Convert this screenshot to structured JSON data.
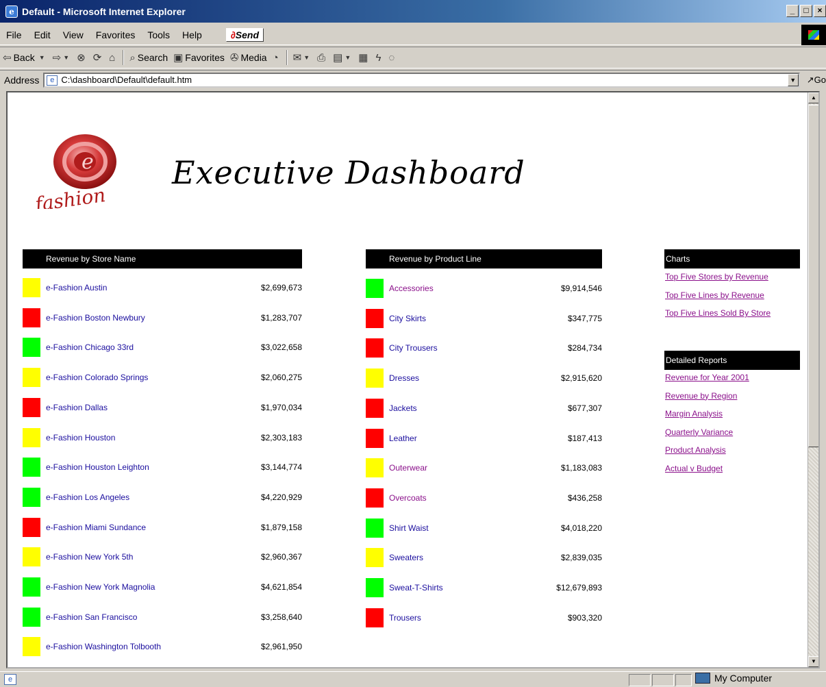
{
  "window": {
    "title": "Default - Microsoft Internet Explorer",
    "buttons": [
      "_",
      "□",
      "×"
    ]
  },
  "menu": [
    "File",
    "Edit",
    "View",
    "Favorites",
    "Tools",
    "Help"
  ],
  "send_label": "Send",
  "toolbar": {
    "back": "Back",
    "search": "Search",
    "favorites": "Favorites",
    "media": "Media"
  },
  "address": {
    "label": "Address",
    "url": "C:\\dashboard\\Default\\default.htm",
    "go": "Go"
  },
  "page": {
    "logo_text": "fashion",
    "logo_letter": "e",
    "title": "Executive Dashboard"
  },
  "colors": {
    "green": "#00ff00",
    "yellow": "#ffff00",
    "red": "#ff0000"
  },
  "store_panel": {
    "header": "Revenue by Store Name",
    "rows": [
      {
        "name": "e-Fashion Austin",
        "value": "$2,699,673",
        "status": "yellow"
      },
      {
        "name": "e-Fashion Boston Newbury",
        "value": "$1,283,707",
        "status": "red"
      },
      {
        "name": "e-Fashion Chicago 33rd",
        "value": "$3,022,658",
        "status": "green"
      },
      {
        "name": "e-Fashion Colorado Springs",
        "value": "$2,060,275",
        "status": "yellow"
      },
      {
        "name": "e-Fashion Dallas",
        "value": "$1,970,034",
        "status": "red"
      },
      {
        "name": "e-Fashion Houston",
        "value": "$2,303,183",
        "status": "yellow"
      },
      {
        "name": "e-Fashion Houston Leighton",
        "value": "$3,144,774",
        "status": "green"
      },
      {
        "name": "e-Fashion Los Angeles",
        "value": "$4,220,929",
        "status": "green"
      },
      {
        "name": "e-Fashion Miami Sundance",
        "value": "$1,879,158",
        "status": "red"
      },
      {
        "name": "e-Fashion New York 5th",
        "value": "$2,960,367",
        "status": "yellow"
      },
      {
        "name": "e-Fashion New York Magnolia",
        "value": "$4,621,854",
        "status": "green"
      },
      {
        "name": "e-Fashion San Francisco",
        "value": "$3,258,640",
        "status": "green"
      },
      {
        "name": "e-Fashion Washington Tolbooth",
        "value": "$2,961,950",
        "status": "yellow"
      }
    ]
  },
  "product_panel": {
    "header": "Revenue by Product Line",
    "rows": [
      {
        "name": "Accessories",
        "value": "$9,914,546",
        "status": "green"
      },
      {
        "name": "City Skirts",
        "value": "$347,775",
        "status": "red"
      },
      {
        "name": "City Trousers",
        "value": "$284,734",
        "status": "red"
      },
      {
        "name": "Dresses",
        "value": "$2,915,620",
        "status": "yellow"
      },
      {
        "name": "Jackets",
        "value": "$677,307",
        "status": "red"
      },
      {
        "name": "Leather",
        "value": "$187,413",
        "status": "red"
      },
      {
        "name": "Outerwear",
        "value": "$1,183,083",
        "status": "yellow"
      },
      {
        "name": "Overcoats",
        "value": "$436,258",
        "status": "red"
      },
      {
        "name": "Shirt Waist",
        "value": "$4,018,220",
        "status": "green"
      },
      {
        "name": "Sweaters",
        "value": "$2,839,035",
        "status": "yellow"
      },
      {
        "name": "Sweat-T-Shirts",
        "value": "$12,679,893",
        "status": "green"
      },
      {
        "name": "Trousers",
        "value": "$903,320",
        "status": "red"
      }
    ]
  },
  "charts_panel": {
    "header": "Charts",
    "links": [
      "Top Five Stores by Revenue",
      "Top Five Lines by Revenue",
      "Top Five Lines Sold By Store"
    ]
  },
  "reports_panel": {
    "header": "Detailed Reports",
    "links": [
      "Revenue for Year 2001",
      "Revenue by Region",
      "Margin Analysis",
      "Quarterly Variance",
      "Product Analysis",
      "Actual v Budget"
    ]
  },
  "status": {
    "zone": "My Computer"
  }
}
